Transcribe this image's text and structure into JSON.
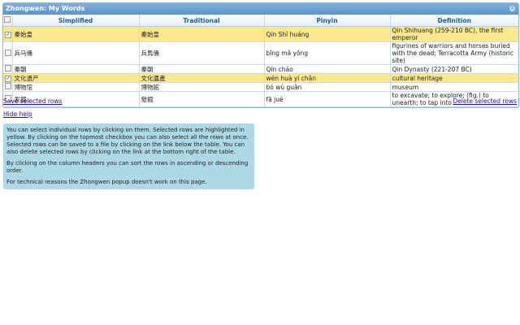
{
  "window": {
    "title": "Zhongwen: My Words"
  },
  "table": {
    "headers": [
      "Simplified",
      "Traditional",
      "Pinyin",
      "Definition"
    ],
    "rows": [
      {
        "selected": true,
        "simplified": "秦始皇",
        "traditional": "秦始皇",
        "pinyin": "Qín Shǐ huáng",
        "definition": "Qin Shihuang (259-210 BC), the first emperor"
      },
      {
        "selected": false,
        "simplified": "兵马俑",
        "traditional": "兵馬俑",
        "pinyin": "bīng mǎ yǒng",
        "definition": "figurines of warriors and horses buried with the dead; Terracotta Army (historic site)"
      },
      {
        "selected": false,
        "simplified": "秦朝",
        "traditional": "秦朝",
        "pinyin": "Qín cháo",
        "definition": "Qin Dynasty (221-207 BC)"
      },
      {
        "selected": true,
        "simplified": "文化遗产",
        "traditional": "文化遺產",
        "pinyin": "wén huà yí chǎn",
        "definition": "cultural heritage"
      },
      {
        "selected": false,
        "simplified": "博物馆",
        "traditional": "博物館",
        "pinyin": "bó wù guǎn",
        "definition": "museum"
      },
      {
        "selected": false,
        "simplified": "发掘",
        "traditional": "發掘",
        "pinyin": "fā jué",
        "definition": "to excavate; to explore; (fig.) to unearth; to tap into"
      }
    ]
  },
  "links": {
    "save": "Save selected rows",
    "delete": "Delete selected rows",
    "hide_help": "Hide help"
  },
  "help": [
    "You can select individual rows by clicking on them. Selected rows are highlighted in yellow. By clicking on the topmost checkbox you can also select all the rows at once. Selected rows can be saved to a file by clicking on the link below the table. You can also delete selected rows by clicking on the link at the bottom right of the table.",
    "By clicking on the column headers you can sort the rows in ascending or descending order.",
    "For technical reasons the Zhongwen popup doesn't work on this page."
  ]
}
